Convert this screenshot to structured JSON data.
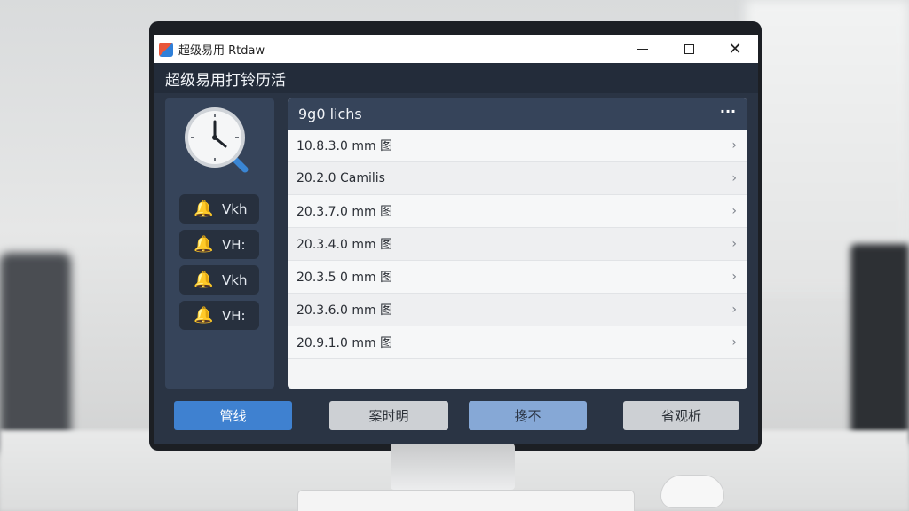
{
  "window": {
    "title": "超级易用 Rtdaw"
  },
  "app_header": {
    "title": "超级易用打铃历活"
  },
  "alarms": [
    {
      "label": "Vkh"
    },
    {
      "label": "VH:"
    },
    {
      "label": "Vkh"
    },
    {
      "label": "VH:"
    }
  ],
  "list": {
    "title": "9g0 lichs",
    "more_label": "···",
    "rows": [
      {
        "text": "10.8.3.0 mm 图"
      },
      {
        "text": "20.2.0 Camilis"
      },
      {
        "text": "20.3.7.0 mm 图"
      },
      {
        "text": "20.3.4.0 mm 图"
      },
      {
        "text": "20.3.5 0 mm 图"
      },
      {
        "text": "20.3.6.0 mm 图"
      },
      {
        "text": "20.9.1.0 mm 图"
      }
    ]
  },
  "buttons": {
    "primary": "管线",
    "second": "案时明",
    "third": "搀不",
    "fourth": "省观析"
  },
  "colors": {
    "accent": "#3f81d0",
    "panel": "#36445a",
    "bell": "#f3a81e"
  }
}
